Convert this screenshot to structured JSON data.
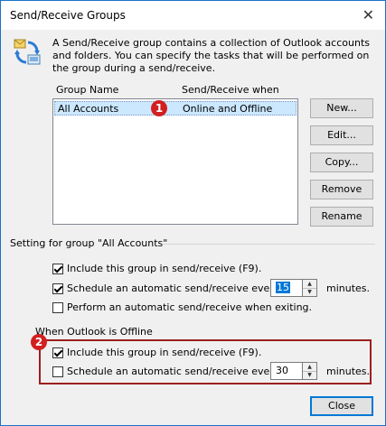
{
  "window": {
    "title": "Send/Receive Groups",
    "close_glyph": "✕"
  },
  "intro": {
    "text": "A Send/Receive group contains a collection of Outlook accounts and folders. You can specify the tasks that will be performed on the group during a send/receive."
  },
  "groups": {
    "columns": [
      "Group Name",
      "Send/Receive when"
    ],
    "rows": [
      {
        "name": "All Accounts",
        "when": "Online and Offline"
      }
    ]
  },
  "buttons": {
    "new": "New...",
    "edit": "Edit...",
    "copy": "Copy...",
    "remove": "Remove",
    "rename": "Rename",
    "close": "Close"
  },
  "setting": {
    "heading": "Setting for group \"All Accounts\"",
    "include_label": "Include this group in send/receive (F9).",
    "include_checked": true,
    "schedule_label": "Schedule an automatic send/receive every",
    "schedule_checked": true,
    "schedule_value": "15",
    "minutes_label": "minutes.",
    "exit_label": "Perform an automatic send/receive when exiting.",
    "exit_checked": false
  },
  "offline": {
    "heading": "When Outlook is Offline",
    "include_label": "Include this group in send/receive (F9).",
    "include_checked": true,
    "schedule_label": "Schedule an automatic send/receive every",
    "schedule_checked": false,
    "schedule_value": "30",
    "minutes_label": "minutes."
  },
  "annotations": {
    "badge1": "1",
    "badge2": "2"
  },
  "colors": {
    "badge": "#d21f1f",
    "selection": "#cce8ff",
    "highlight_box": "#9b1f1f",
    "accent": "#0078d7"
  }
}
